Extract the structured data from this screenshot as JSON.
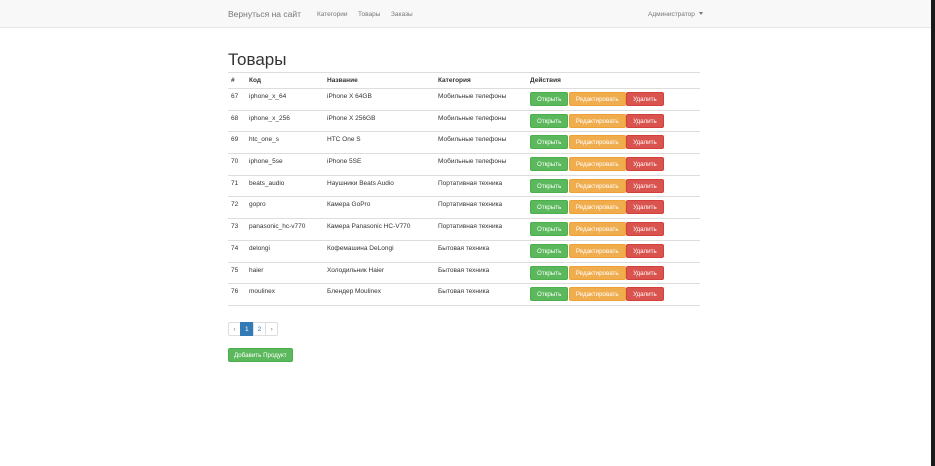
{
  "navbar": {
    "brand": "Вернуться на сайт",
    "links": [
      "Категории",
      "Товары",
      "Заказы"
    ],
    "user_menu": "Администратор"
  },
  "page": {
    "title": "Товары"
  },
  "table": {
    "headers": [
      "#",
      "Код",
      "Название",
      "Категория",
      "Действия"
    ],
    "rows": [
      {
        "id": "67",
        "code": "iphone_x_64",
        "name": "iPhone X 64GB",
        "category": "Мобильные телефоны"
      },
      {
        "id": "68",
        "code": "iphone_x_256",
        "name": "iPhone X 256GB",
        "category": "Мобильные телефоны"
      },
      {
        "id": "69",
        "code": "htc_one_s",
        "name": "HTC One S",
        "category": "Мобильные телефоны"
      },
      {
        "id": "70",
        "code": "iphone_5se",
        "name": "iPhone 5SE",
        "category": "Мобильные телефоны"
      },
      {
        "id": "71",
        "code": "beats_audio",
        "name": "Наушники Beats Audio",
        "category": "Портативная техника"
      },
      {
        "id": "72",
        "code": "gopro",
        "name": "Камера GoPro",
        "category": "Портативная техника"
      },
      {
        "id": "73",
        "code": "panasonic_hc-v770",
        "name": "Камера Panasonic HC-V770",
        "category": "Портативная техника"
      },
      {
        "id": "74",
        "code": "delongi",
        "name": "Кофемашина DeLongi",
        "category": "Бытовая техника"
      },
      {
        "id": "75",
        "code": "haier",
        "name": "Холодильник Haier",
        "category": "Бытовая техника"
      },
      {
        "id": "76",
        "code": "moulinex",
        "name": "Блендер Moulinex",
        "category": "Бытовая техника"
      }
    ],
    "actions": {
      "open": "Открыть",
      "edit": "Редактировать",
      "delete": "Удалить"
    }
  },
  "pagination": {
    "prev": "‹",
    "pages": [
      "1",
      "2"
    ],
    "current": "1",
    "next": "›"
  },
  "add_button": "Добавить Продукт",
  "colors": {
    "success": "#5cb85c",
    "warning": "#f0ad4e",
    "danger": "#d9534f",
    "primary": "#337ab7"
  }
}
